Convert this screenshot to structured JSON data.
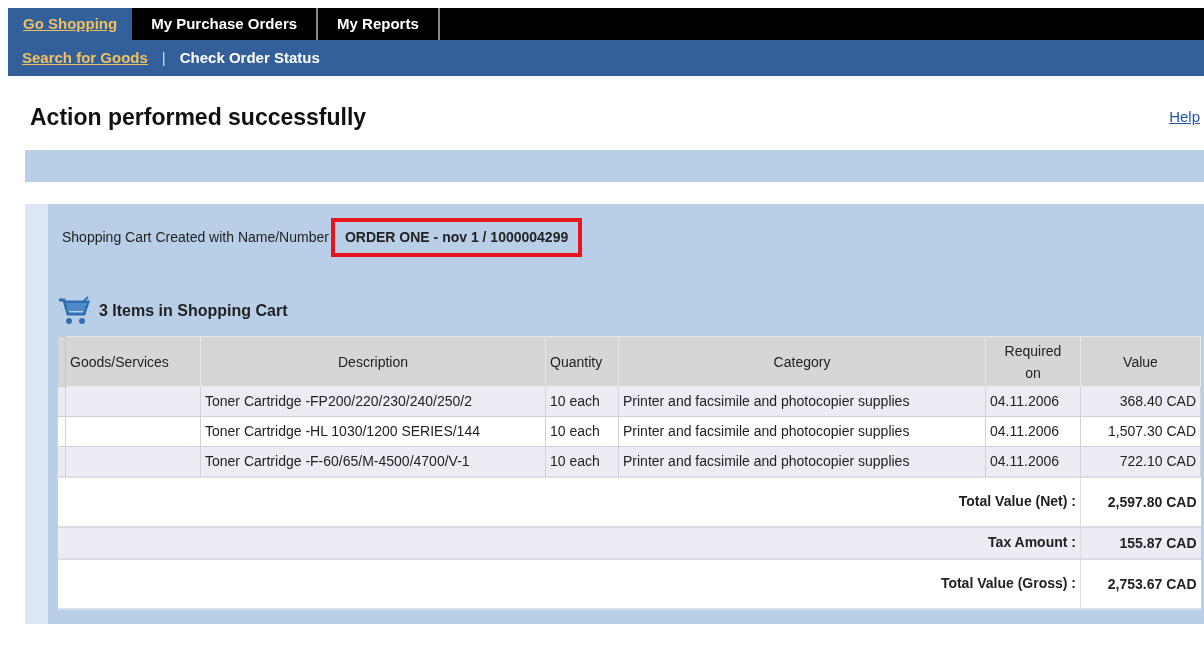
{
  "tabs": [
    {
      "label": "Go Shopping",
      "selected": true
    },
    {
      "label": "My Purchase Orders",
      "selected": false
    },
    {
      "label": "My Reports",
      "selected": false
    }
  ],
  "subnav": [
    {
      "label": "Search for Goods",
      "selected": true
    },
    {
      "label": "Check Order Status",
      "selected": false
    }
  ],
  "subnav_separator": "|",
  "heading": "Action performed successfully",
  "help_link": "Help",
  "confirmation": {
    "label": "Shopping Cart Created with Name/Number",
    "value": "ORDER ONE - nov 1 / 1000004299",
    "highlighted": true
  },
  "cart_title": "3 Items in Shopping Cart",
  "table": {
    "columns": [
      "Goods/Services",
      "Description",
      "Quantity",
      "Category",
      "Required on",
      "Value"
    ],
    "rows": [
      {
        "goods_services": "",
        "description": "Toner Cartridge -FP200/220/230/240/250/2",
        "quantity": "10 each",
        "category": "Printer and facsimile and photocopier supplies",
        "required_on": "04.11.2006",
        "value": "368.40 CAD"
      },
      {
        "goods_services": "",
        "description": "Toner Cartridge -HL 1030/1200 SERIES/144",
        "quantity": "10 each",
        "category": "Printer and facsimile and photocopier supplies",
        "required_on": "04.11.2006",
        "value": "1,507.30 CAD"
      },
      {
        "goods_services": "",
        "description": "Toner Cartridge -F-60/65/M-4500/4700/V-1",
        "quantity": "10 each",
        "category": "Printer and facsimile and photocopier supplies",
        "required_on": "04.11.2006",
        "value": "722.10 CAD"
      }
    ],
    "totals": [
      {
        "label": "Total Value (Net) :",
        "value": "2,597.80 CAD"
      },
      {
        "label": "Tax Amount :",
        "value": "155.87 CAD"
      },
      {
        "label": "Total Value (Gross) :",
        "value": "2,753.67 CAD"
      }
    ]
  }
}
